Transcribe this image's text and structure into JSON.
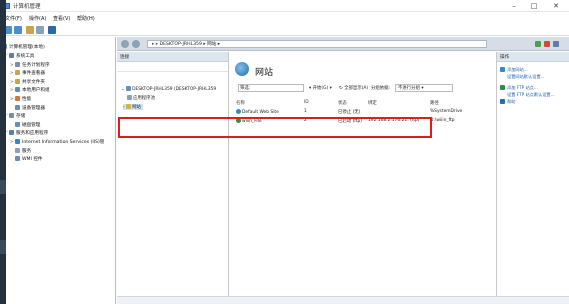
{
  "window": {
    "title": "计算机管理"
  },
  "menu": [
    "文件(F)",
    "操作(A)",
    "查看(V)",
    "帮助(H)"
  ],
  "tree": {
    "root": "计算机管理(本地)",
    "items": [
      {
        "label": "系统工具",
        "level": 1,
        "expander": "﹀"
      },
      {
        "label": "任务计划程序",
        "level": 2,
        "expander": ">"
      },
      {
        "label": "事件查看器",
        "level": 2,
        "expander": ">"
      },
      {
        "label": "共享文件夹",
        "level": 2,
        "expander": ">"
      },
      {
        "label": "本地用户和组",
        "level": 2,
        "expander": ">"
      },
      {
        "label": "性能",
        "level": 2,
        "expander": ">"
      },
      {
        "label": "设备管理器",
        "level": 2,
        "expander": ""
      },
      {
        "label": "存储",
        "level": 1,
        "expander": "﹀"
      },
      {
        "label": "磁盘管理",
        "level": 2,
        "expander": ""
      },
      {
        "label": "服务和应用程序",
        "level": 1,
        "expander": "﹀"
      },
      {
        "label": "Internet Information Services (IIS)管",
        "level": 2,
        "expander": ">"
      },
      {
        "label": "服务",
        "level": 2,
        "expander": ""
      },
      {
        "label": "WMI 控件",
        "level": 2,
        "expander": ""
      }
    ]
  },
  "iis": {
    "breadcrumb": [
      "DESKTOP-JRHL359",
      "网站"
    ],
    "connections": {
      "header": "连接",
      "server": "DESKTOP-JRHL359 (DESKTOP-JRHL359",
      "pools": "应用程序池",
      "sites": "网站"
    },
    "center": {
      "title": "网站",
      "filter_label": "筛选:",
      "start_label": "开始(G)",
      "show_all_label": "全部显示(A)",
      "group_label": "分组依据:",
      "group_value": "不进行分组",
      "columns": [
        "名称",
        "ID",
        "状态",
        "绑定",
        "路径"
      ],
      "rows": [
        [
          "Default Web Site",
          "1",
          "已停止 (无)",
          "",
          "%SystemDrive"
        ],
        [
          "wiiin_File",
          "2",
          "已启动 (ftp)",
          "192.168.2.176:21: (ftp)",
          "D:\\wiiin_ftp"
        ]
      ]
    },
    "actions": {
      "header": "操作",
      "items": [
        "添加网站...",
        "设置网站默认设置...",
        "添加 FTP 站点...",
        "设置 FTP 站点默认设置...",
        "帮助"
      ]
    }
  }
}
